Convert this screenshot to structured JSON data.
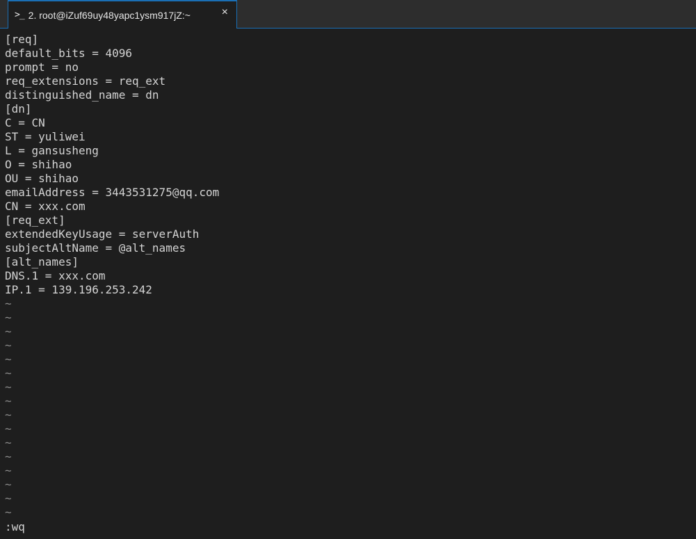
{
  "tab": {
    "icon": ">_",
    "title": "2. root@iZuf69uy48yapc1ysm917jZ:~",
    "close": "×"
  },
  "file_lines": [
    "[req]",
    "default_bits = 4096",
    "prompt = no",
    "req_extensions = req_ext",
    "distinguished_name = dn",
    "[dn]",
    "C = CN",
    "ST = yuliwei",
    "L = gansusheng",
    "O = shihao",
    "OU = shihao",
    "emailAddress = 3443531275@qq.com",
    "CN = xxx.com",
    "[req_ext]",
    "extendedKeyUsage = serverAuth",
    "subjectAltName = @alt_names",
    "[alt_names]",
    "DNS.1 = xxx.com",
    "IP.1 = 139.196.253.242"
  ],
  "tilde_lines": [
    "~",
    "~",
    "~",
    "~",
    "~",
    "~",
    "~",
    "~",
    "~",
    "~",
    "~",
    "~",
    "~",
    "~",
    "~",
    "~"
  ],
  "command": ":wq",
  "colors": {
    "background": "#1e1e1e",
    "accent": "#1a6fb5",
    "text": "#d4d4d4",
    "tilde": "#8a8a8a"
  }
}
